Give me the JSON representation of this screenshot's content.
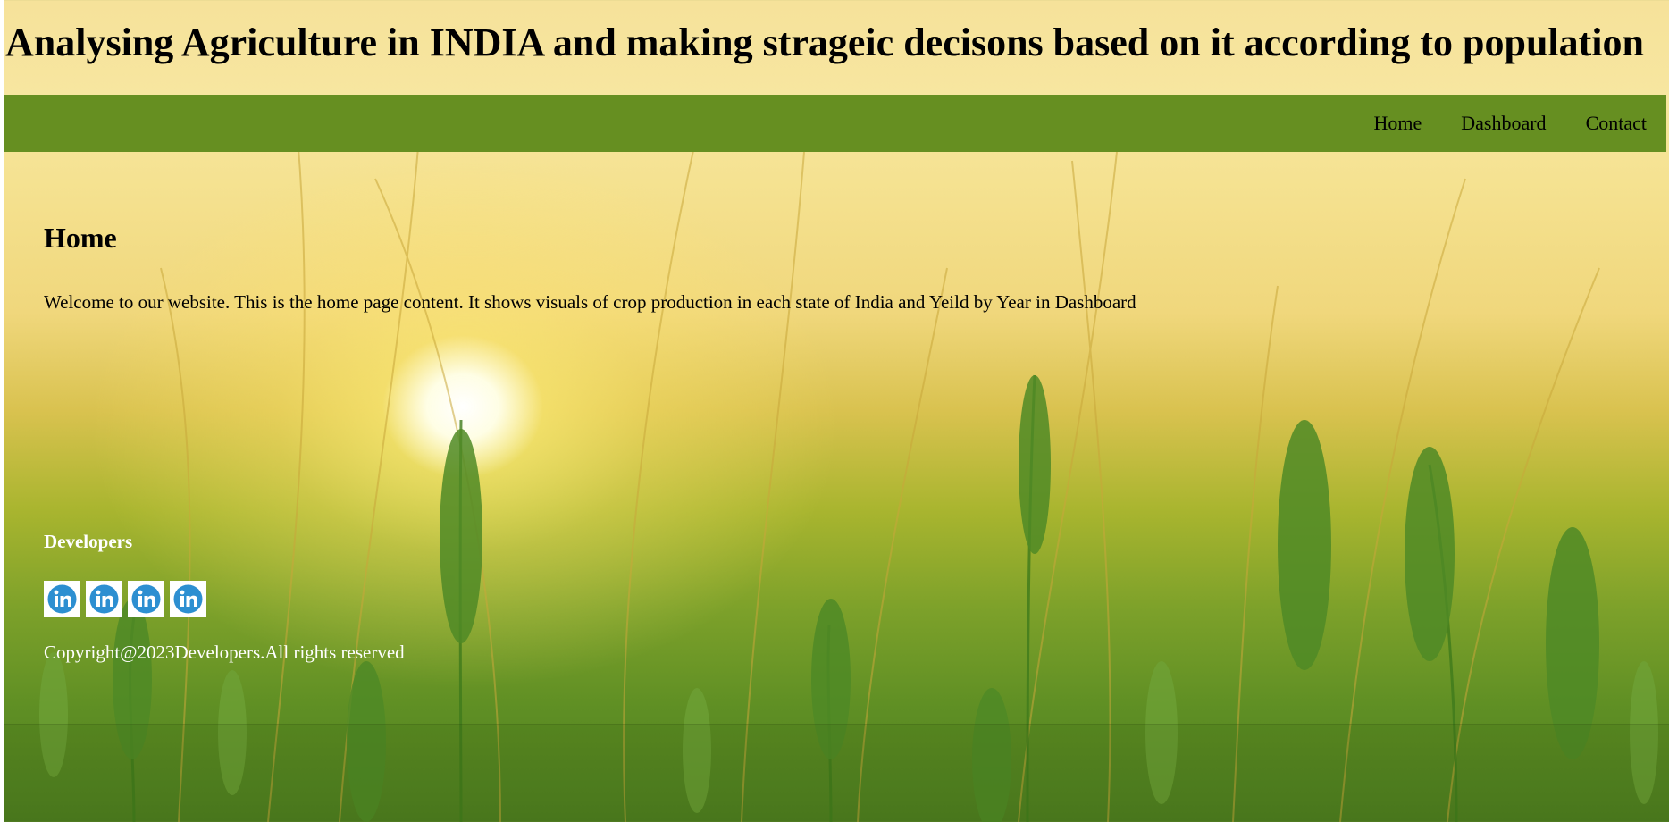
{
  "header": {
    "title": "Analysing Agriculture in INDIA and making strageic decisons based on it according to population"
  },
  "nav": {
    "items": [
      {
        "label": "Home"
      },
      {
        "label": "Dashboard"
      },
      {
        "label": "Contact"
      }
    ]
  },
  "main": {
    "heading": "Home",
    "text": "Welcome to our website. This is the home page content. It shows visuals of crop production in each state of India and Yeild by Year in Dashboard"
  },
  "footer": {
    "heading": "Developers",
    "social_links": [
      {
        "icon": "linkedin-icon"
      },
      {
        "icon": "linkedin-icon"
      },
      {
        "icon": "linkedin-icon"
      },
      {
        "icon": "linkedin-icon"
      }
    ],
    "copyright": "Copyright@2023Developers.All rights reserved"
  },
  "colors": {
    "navbar": "#668f21",
    "linkedin": "#2d8fd1",
    "footer_text": "#ffffff"
  }
}
